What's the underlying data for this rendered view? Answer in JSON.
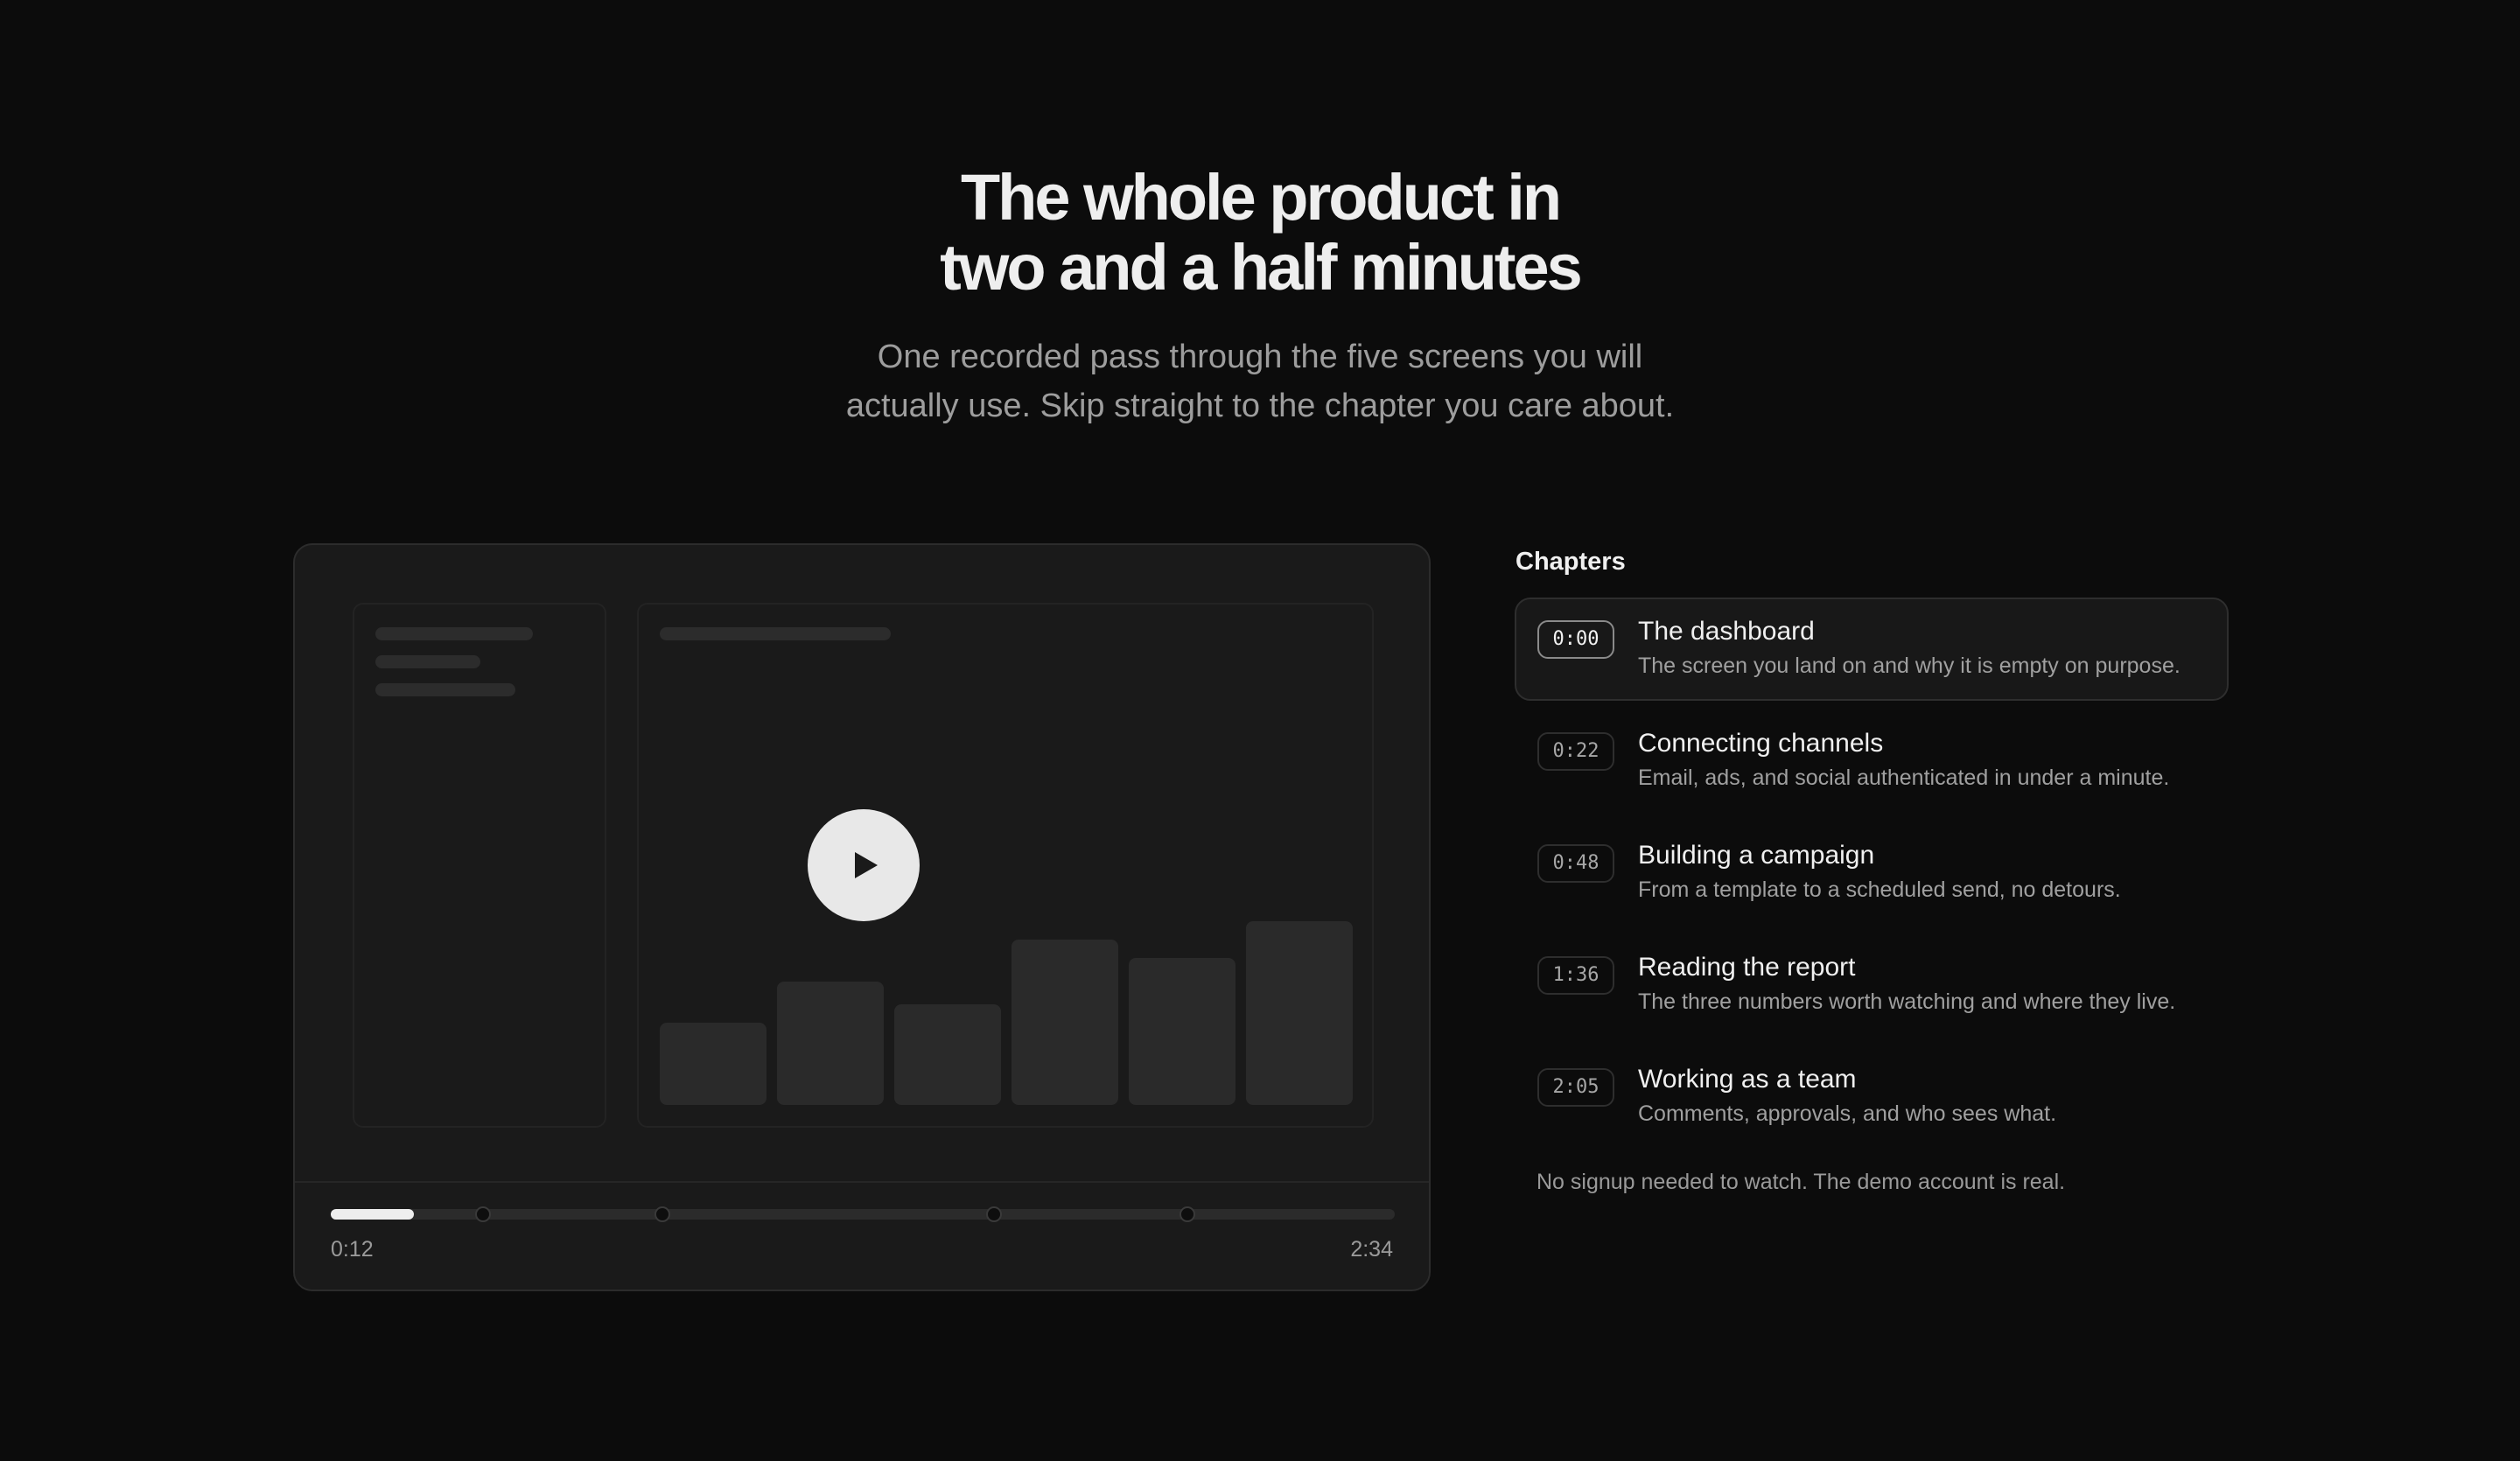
{
  "hero": {
    "title_line1": "The whole product in",
    "title_line2": "two and a half minutes",
    "subtitle_line1": "One recorded pass through the five screens you will",
    "subtitle_line2": "actually use. Skip straight to the chapter you care about."
  },
  "player": {
    "current_time": "0:12",
    "duration": "2:34",
    "progress_fraction": 0.078,
    "play_icon": "play-icon",
    "chapter_marker_fractions": [
      0.143,
      0.312,
      0.623,
      0.805
    ],
    "mock_bar_levels": [
      0.45,
      0.67,
      0.55,
      0.9,
      0.8,
      1.0
    ]
  },
  "chapters": {
    "heading": "Chapters",
    "items": [
      {
        "time": "0:00",
        "title": "The dashboard",
        "description": "The screen you land on and why it is empty on purpose.",
        "active": true
      },
      {
        "time": "0:22",
        "title": "Connecting channels",
        "description": "Email, ads, and social authenticated in under a minute.",
        "active": false
      },
      {
        "time": "0:48",
        "title": "Building a campaign",
        "description": "From a template to a scheduled send, no detours.",
        "active": false
      },
      {
        "time": "1:36",
        "title": "Reading the report",
        "description": "The three numbers worth watching and where they live.",
        "active": false
      },
      {
        "time": "2:05",
        "title": "Working as a team",
        "description": "Comments, approvals, and who sees what.",
        "active": false
      }
    ],
    "note": "No signup needed to watch. The demo account is real."
  },
  "colors": {
    "background": "#0c0c0c",
    "panel": "#1a1a1a",
    "accent": "#eeeeee",
    "muted_text": "#9d9d9d"
  }
}
